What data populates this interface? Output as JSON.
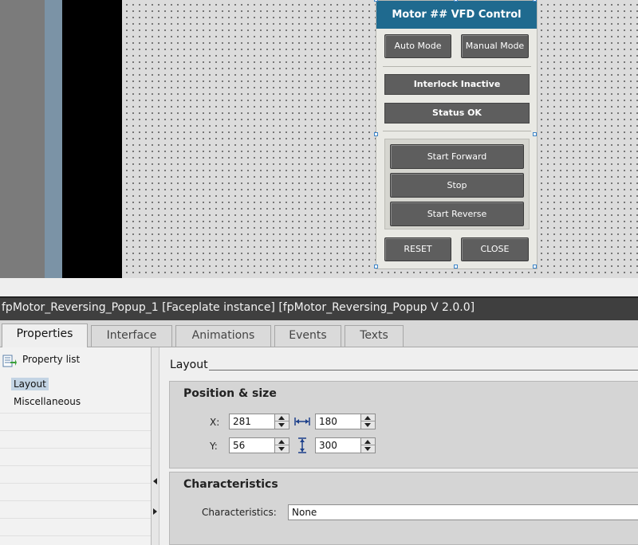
{
  "faceplate": {
    "title": "Motor ## VFD Control",
    "auto_mode_label": "Auto Mode",
    "manual_mode_label": "Manual Mode",
    "interlock_status": "Interlock Inactive",
    "status_text": "Status OK",
    "start_forward_label": "Start Forward",
    "stop_label": "Stop",
    "start_reverse_label": "Start Reverse",
    "reset_label": "RESET",
    "close_label": "CLOSE"
  },
  "inspector": {
    "title": "fpMotor_Reversing_Popup_1 [Faceplate instance] [fpMotor_Reversing_Popup V 2.0.0]",
    "tabs": [
      "Properties",
      "Interface",
      "Animations",
      "Events",
      "Texts"
    ],
    "active_tab": "Properties",
    "property_list_label": "Property list",
    "nav_items": [
      "Layout",
      "Miscellaneous"
    ],
    "selected_nav": "Layout",
    "layout_heading": "Layout",
    "position_size": {
      "title": "Position & size",
      "x_label": "X:",
      "x_value": "281",
      "y_label": "Y:",
      "y_value": "56",
      "width_value": "180",
      "height_value": "300",
      "width_icon": "width-arrows-icon",
      "height_icon": "height-arrows-icon"
    },
    "characteristics": {
      "title": "Characteristics",
      "label": "Characteristics:",
      "value": "None"
    }
  },
  "colors": {
    "faceplate_header": "#1f6a8f",
    "button_gray": "#5e5e5e",
    "title_bar": "#3f3f3f",
    "selection_handle": "#3c84c8",
    "selected_nav": "#c3d4e4"
  }
}
